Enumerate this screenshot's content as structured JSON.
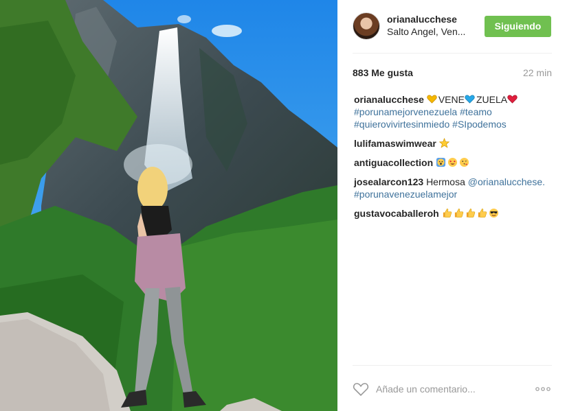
{
  "post": {
    "username": "orianalucchese",
    "location": "Salto Angel, Ven...",
    "follow_label": "Siguiendo",
    "likes": "883 Me gusta",
    "time": "22 min"
  },
  "caption": {
    "user": "orianalucchese",
    "part1": "VENE",
    "part2": "ZUELA",
    "hashtags_line1": "#porunamejorvenezuela #teamo",
    "hashtags_line2": "#quierovivirtesinmiedo #SIpodemos"
  },
  "comments": [
    {
      "user": "lulifamaswimwear",
      "emojis": [
        "star"
      ]
    },
    {
      "user": "antiguacollection",
      "emojis": [
        "face-screaming",
        "heart-eyes",
        "kiss-face"
      ]
    },
    {
      "user": "josealarcon123",
      "text": "Hermosa",
      "mention": "@orianalucchese.",
      "hashtag": "#porunavenezuelamejor"
    },
    {
      "user": "gustavocaballeroh",
      "emojis": [
        "thumbs-up",
        "thumbs-up",
        "thumbs-up",
        "thumbs-up",
        "sunglasses-face"
      ]
    }
  ],
  "add_comment": {
    "placeholder": "Añade un comentario..."
  },
  "icons": {
    "like": "heart-icon",
    "more": "more-options-icon"
  },
  "colors": {
    "follow_button": "#70c050",
    "hashtag": "#3f729b",
    "muted": "#999999"
  }
}
